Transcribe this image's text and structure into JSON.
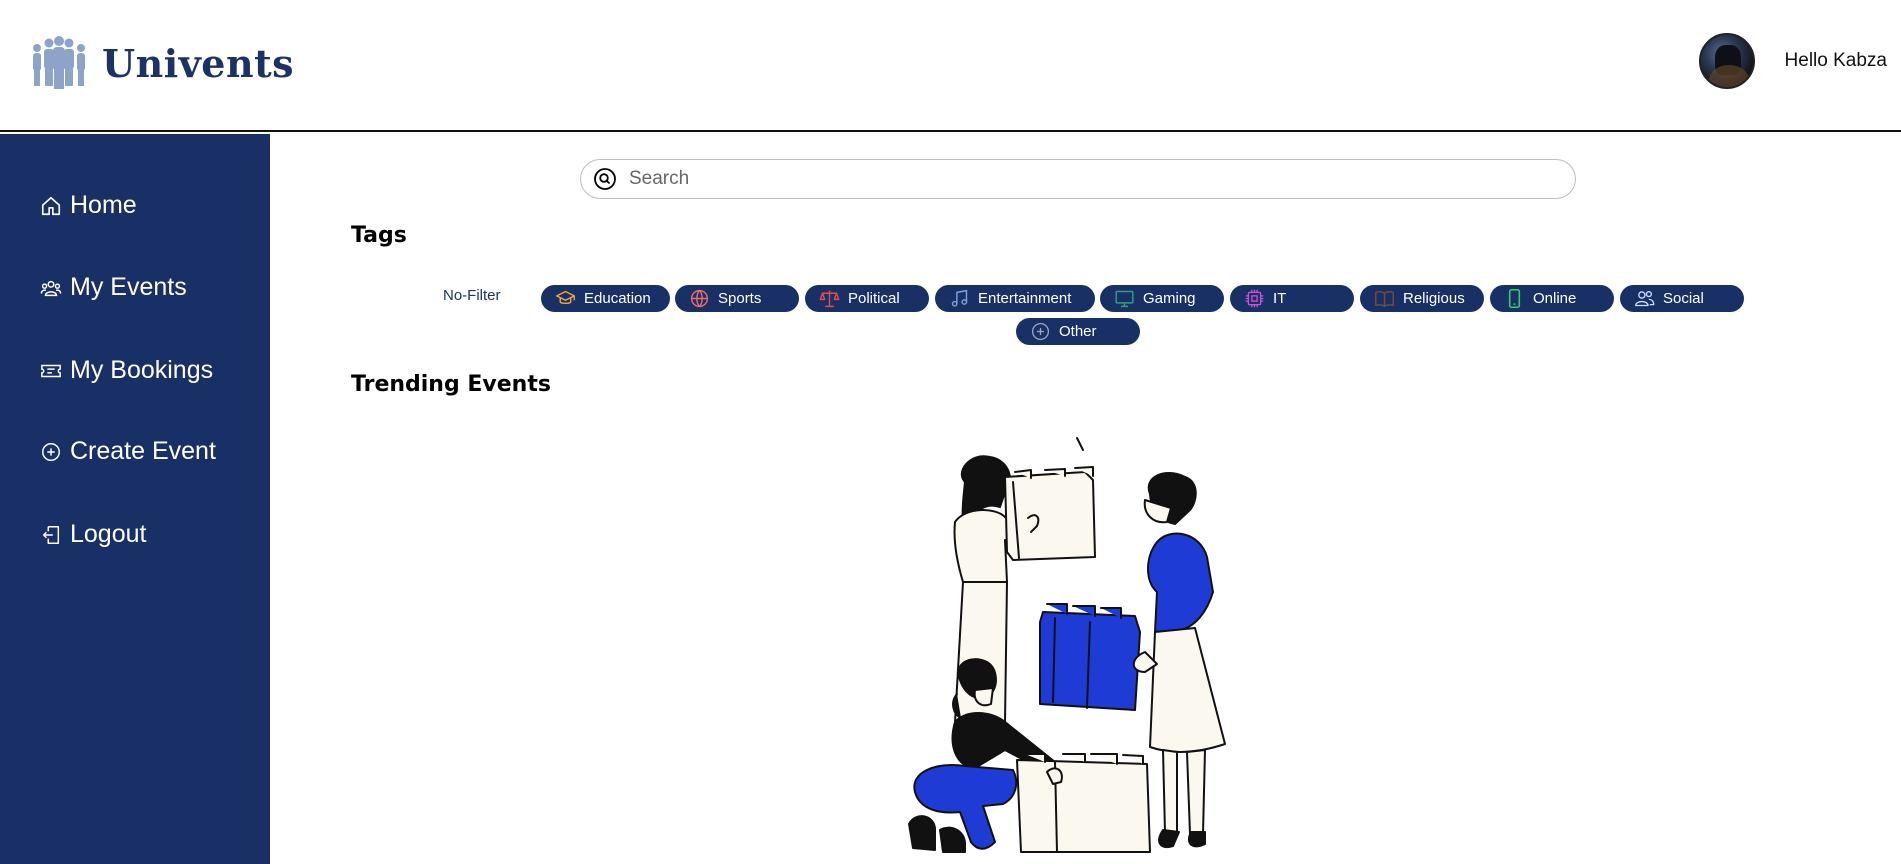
{
  "header": {
    "brand": "Univents",
    "greeting": "Hello Kabza"
  },
  "sidebar": {
    "items": [
      {
        "label": "Home",
        "icon": "home-icon"
      },
      {
        "label": "My Events",
        "icon": "users-icon"
      },
      {
        "label": "My Bookings",
        "icon": "ticket-icon"
      },
      {
        "label": "Create Event",
        "icon": "plus-circle-icon"
      },
      {
        "label": "Logout",
        "icon": "logout-icon"
      }
    ]
  },
  "search": {
    "placeholder": "Search"
  },
  "tags": {
    "title": "Tags",
    "no_filter": "No-Filter",
    "items": [
      {
        "label": "Education",
        "icon": "graduation-cap-icon",
        "color": "#f0a93a"
      },
      {
        "label": "Sports",
        "icon": "ball-icon",
        "color": "#f36b6b"
      },
      {
        "label": "Political",
        "icon": "scales-icon",
        "color": "#e94a4a"
      },
      {
        "label": "Entertainment",
        "icon": "music-note-icon",
        "color": "#7fa3e6"
      },
      {
        "label": "Gaming",
        "icon": "monitor-icon",
        "color": "#2ea37a"
      },
      {
        "label": "IT",
        "icon": "chip-icon",
        "color": "#d150d8"
      },
      {
        "label": "Religious",
        "icon": "book-icon",
        "color": "#7a4a3a"
      },
      {
        "label": "Online",
        "icon": "phone-icon",
        "color": "#2fd35a"
      },
      {
        "label": "Social",
        "icon": "people-icon",
        "color": "#cfe0ff"
      },
      {
        "label": "Other",
        "icon": "plus-circle-icon",
        "color": "#9aa8c0"
      }
    ]
  },
  "trending": {
    "title": "Trending Events"
  },
  "colors": {
    "primary": "#193066",
    "accent_blue": "#1f3bd6"
  }
}
